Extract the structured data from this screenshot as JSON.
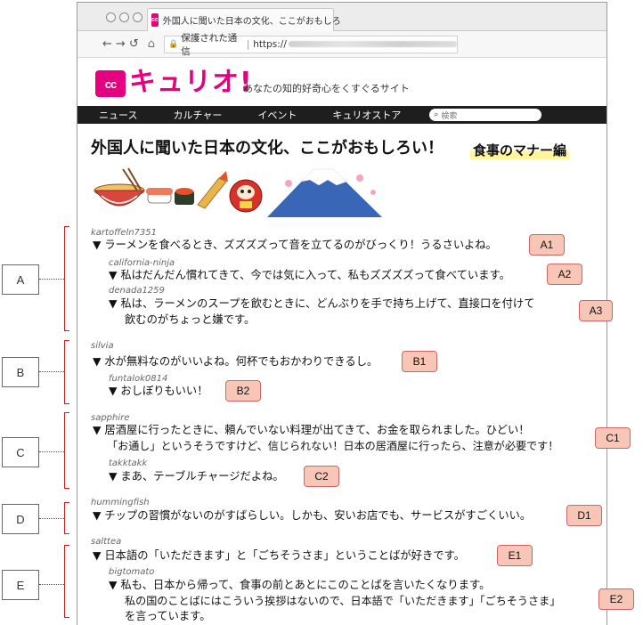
{
  "browser": {
    "tab_title": "外国人に聞いた日本の文化、ここがおもしろ",
    "favicon_text": "cc",
    "nav_icons": [
      "←",
      "→",
      "↺"
    ],
    "secure_label": "保護された通信",
    "url_prefix": "https://"
  },
  "site": {
    "logo_mark": "cc",
    "logo_text": "キュリオ!",
    "tagline": "あなたの知的好奇心をくすぐるサイト",
    "nav": [
      "ニュース",
      "カルチャー",
      "イベント",
      "キュリオストア"
    ],
    "search_placeholder": "検索",
    "brand_color": "#e5007f"
  },
  "article": {
    "title": "外国人に聞いた日本の文化、ここがおもしろい！",
    "subtitle": "食事のマナー編"
  },
  "groups": [
    {
      "label": "A",
      "comments": [
        {
          "user": "kartoffeln7351",
          "lines": [
            "▼ ラーメンを食べるとき、ズズズズって音を立てるのがびっくり！うるさいよね。"
          ],
          "badge": "A1"
        },
        {
          "user": "california-ninja",
          "lines": [
            "▼ 私はだんだん慣れてきて、今では気に入って、私もズズズズって食べています。"
          ],
          "badge": "A2"
        },
        {
          "user": "denada1259",
          "lines": [
            "▼ 私は、ラーメンのスープを飲むときに、どんぶりを手で持ち上げて、直接口を付けて",
            "飲むのがちょっと嫌です。"
          ],
          "badge": "A3"
        }
      ]
    },
    {
      "label": "B",
      "comments": [
        {
          "user": "silvia",
          "lines": [
            "▼ 水が無料なのがいいよね。何杯でもおかわりできるし。"
          ],
          "badge": "B1"
        },
        {
          "user": "funtalok0814",
          "lines": [
            "▼ おしぼりもいい！"
          ],
          "badge": "B2"
        }
      ]
    },
    {
      "label": "C",
      "comments": [
        {
          "user": "sapphire",
          "lines": [
            "▼ 居酒屋に行ったときに、頼んでいない料理が出てきて、お金を取られました。ひどい！",
            "「お通し」というそうですけど、信じられない！日本の居酒屋に行ったら、注意が必要です！"
          ],
          "badge": "C1"
        },
        {
          "user": "takktakk",
          "lines": [
            "▼ まあ、テーブルチャージだよね。"
          ],
          "badge": "C2"
        }
      ]
    },
    {
      "label": "D",
      "comments": [
        {
          "user": "hummingfish",
          "lines": [
            "▼ チップの習慣がないのがすばらしい。しかも、安いお店でも、サービスがすごくいい。"
          ],
          "badge": "D1"
        }
      ]
    },
    {
      "label": "E",
      "comments": [
        {
          "user": "salttea",
          "lines": [
            "▼ 日本語の「いただきます」と「ごちそうさま」ということばが好きです。"
          ],
          "badge": "E1"
        },
        {
          "user": "bigtomato",
          "lines": [
            "▼ 私も、日本から帰って、食事の前とあとにこのことばを言いたくなります。",
            "私の国のことばにはこういう挨拶はないので、日本語で「いただきます」「ごちそうさま」",
            "を言っています。"
          ],
          "badge": "E2"
        }
      ]
    }
  ]
}
